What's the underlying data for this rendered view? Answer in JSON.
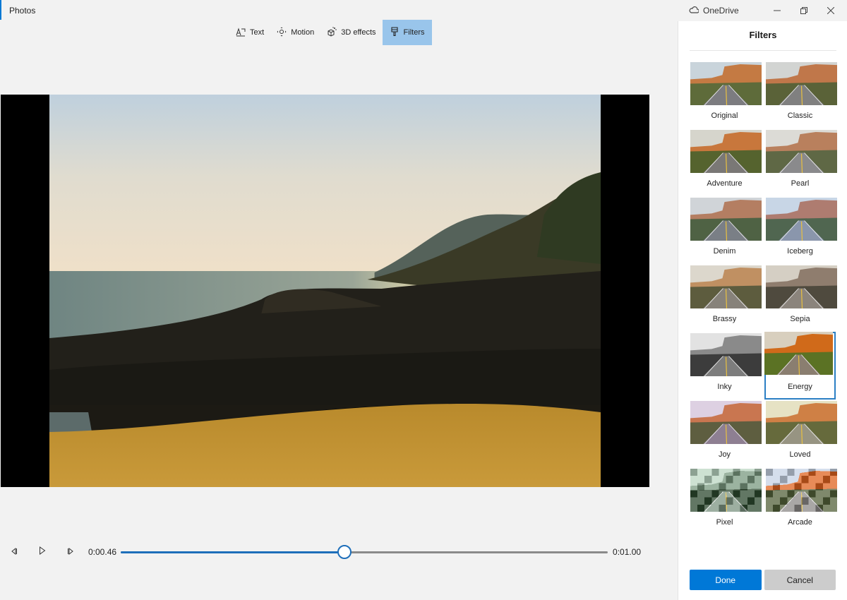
{
  "app": {
    "title": "Photos"
  },
  "window": {
    "onedrive_label": "OneDrive",
    "minimize_glyph": "—",
    "restore_glyph": "❐",
    "close_glyph": "✕"
  },
  "toolbar": {
    "items": [
      {
        "label": "Text",
        "icon": "text-icon",
        "active": false
      },
      {
        "label": "Motion",
        "icon": "motion-icon",
        "active": false
      },
      {
        "label": "3D effects",
        "icon": "3d-effects-icon",
        "active": false
      },
      {
        "label": "Filters",
        "icon": "filters-icon",
        "active": true
      }
    ]
  },
  "preview": {
    "description": "Coastal beach scene with rocks, sea and hillside at dusk"
  },
  "playback": {
    "current_time": "0:00.46",
    "total_time": "0:01.00",
    "progress": 0.46
  },
  "filters_panel": {
    "title": "Filters",
    "selected": "Energy",
    "filters": [
      {
        "name": "Original"
      },
      {
        "name": "Classic"
      },
      {
        "name": "Adventure"
      },
      {
        "name": "Pearl"
      },
      {
        "name": "Denim"
      },
      {
        "name": "Iceberg"
      },
      {
        "name": "Brassy"
      },
      {
        "name": "Sepia"
      },
      {
        "name": "Inky"
      },
      {
        "name": "Energy"
      },
      {
        "name": "Joy"
      },
      {
        "name": "Loved"
      },
      {
        "name": "Pixel"
      },
      {
        "name": "Arcade"
      }
    ],
    "done_label": "Done",
    "cancel_label": "Cancel"
  },
  "colors": {
    "accent": "#0078d7",
    "toolbar_active": "#99c5eb",
    "slider": "#1e6fba",
    "background": "#f2f2f2"
  }
}
